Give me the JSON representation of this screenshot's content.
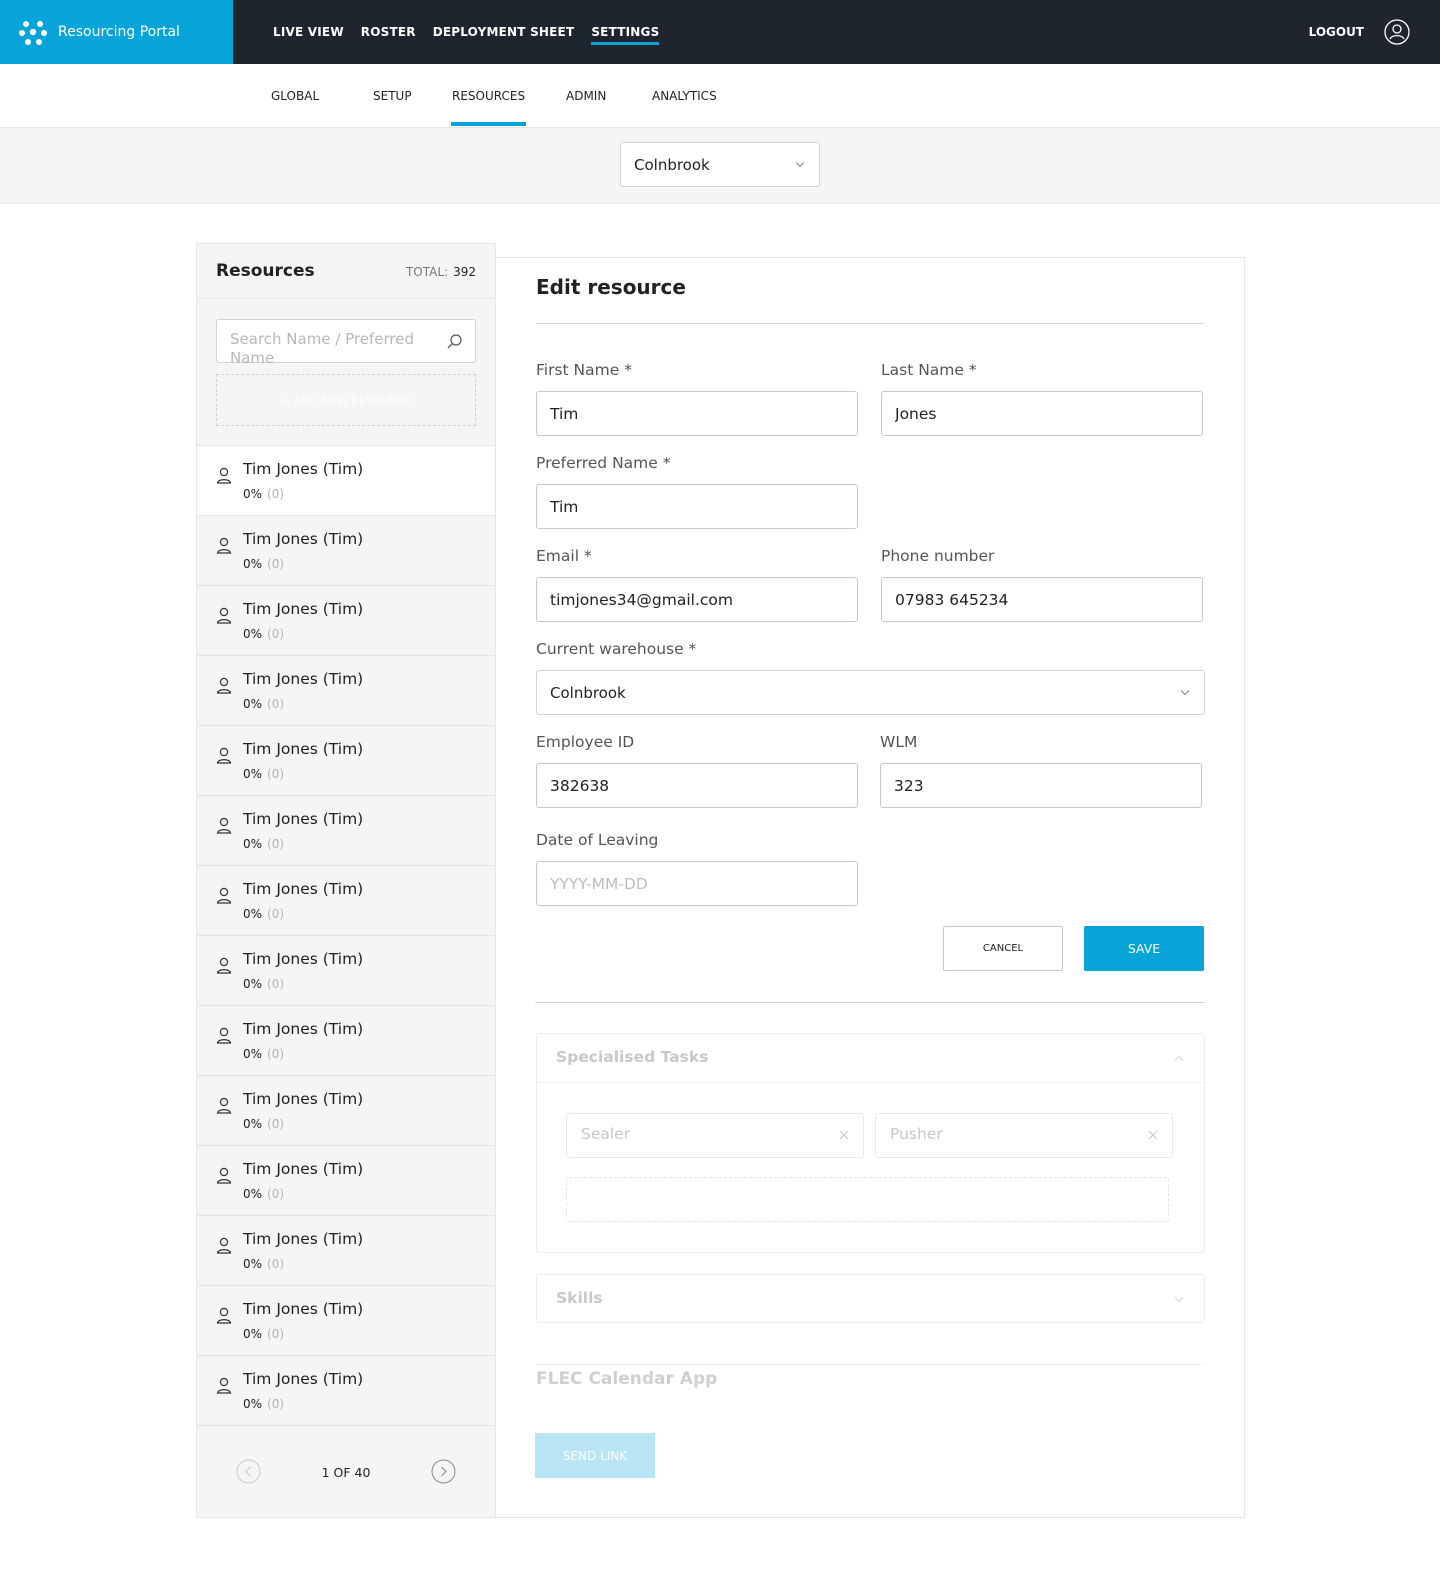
{
  "app": {
    "brand": "Resourcing Portal",
    "nav": [
      "LIVE VIEW",
      "ROSTER",
      "DEPLOYMENT SHEET",
      "SETTINGS"
    ],
    "active_nav": "SETTINGS",
    "logout": "LOGOUT"
  },
  "subnav": {
    "tabs": [
      "GLOBAL",
      "SETUP",
      "RESOURCES",
      "ADMIN",
      "ANALYTICS"
    ],
    "active": "RESOURCES"
  },
  "warehouse_selector": {
    "value": "Colnbrook"
  },
  "resources_panel": {
    "title": "Resources",
    "total_label": "TOTAL:",
    "total_value": "392",
    "search_placeholder": "Search Name / Preferred Name",
    "add_new": "+ ADD NEW RESOURCE",
    "items": [
      {
        "name": "Tim Jones (Tim)",
        "percent": "0%",
        "count": "(0)"
      },
      {
        "name": "Tim Jones (Tim)",
        "percent": "0%",
        "count": "(0)"
      },
      {
        "name": "Tim Jones (Tim)",
        "percent": "0%",
        "count": "(0)"
      },
      {
        "name": "Tim Jones (Tim)",
        "percent": "0%",
        "count": "(0)"
      },
      {
        "name": "Tim Jones (Tim)",
        "percent": "0%",
        "count": "(0)"
      },
      {
        "name": "Tim Jones (Tim)",
        "percent": "0%",
        "count": "(0)"
      },
      {
        "name": "Tim Jones (Tim)",
        "percent": "0%",
        "count": "(0)"
      },
      {
        "name": "Tim Jones (Tim)",
        "percent": "0%",
        "count": "(0)"
      },
      {
        "name": "Tim Jones (Tim)",
        "percent": "0%",
        "count": "(0)"
      },
      {
        "name": "Tim Jones (Tim)",
        "percent": "0%",
        "count": "(0)"
      },
      {
        "name": "Tim Jones (Tim)",
        "percent": "0%",
        "count": "(0)"
      },
      {
        "name": "Tim Jones (Tim)",
        "percent": "0%",
        "count": "(0)"
      },
      {
        "name": "Tim Jones (Tim)",
        "percent": "0%",
        "count": "(0)"
      },
      {
        "name": "Tim Jones (Tim)",
        "percent": "0%",
        "count": "(0)"
      }
    ],
    "pagination": "1 OF 40"
  },
  "edit_resource": {
    "title": "Edit resource",
    "first_name": {
      "label": "First Name *",
      "value": "Tim"
    },
    "last_name": {
      "label": "Last Name *",
      "value": "Jones"
    },
    "preferred_name": {
      "label": "Preferred Name *",
      "value": "Tim"
    },
    "email": {
      "label": "Email *",
      "value": "timjones34@gmail.com"
    },
    "phone": {
      "label": "Phone number",
      "value": "07983 645234"
    },
    "warehouse": {
      "label": "Current warehouse *",
      "value": "Colnbrook"
    },
    "employee_id": {
      "label": "Employee ID",
      "value": "382638"
    },
    "wlm": {
      "label": "WLM",
      "value": "323"
    },
    "date_of_leaving": {
      "label": "Date of Leaving",
      "value": "",
      "placeholder": "YYYY-MM-DD"
    },
    "cancel": "CANCEL",
    "save": "SAVE",
    "specialised_tasks": {
      "title": "Specialised Tasks",
      "tags": [
        "Sealer",
        "Pusher"
      ]
    },
    "skills": {
      "title": "Skills"
    },
    "flec": {
      "title": "FLEC Calendar App",
      "button": "SEND LINK"
    }
  },
  "colors": {
    "accent": "#07a4d9",
    "topbar": "#1f252e",
    "panel_bg": "#f5f5f5"
  }
}
